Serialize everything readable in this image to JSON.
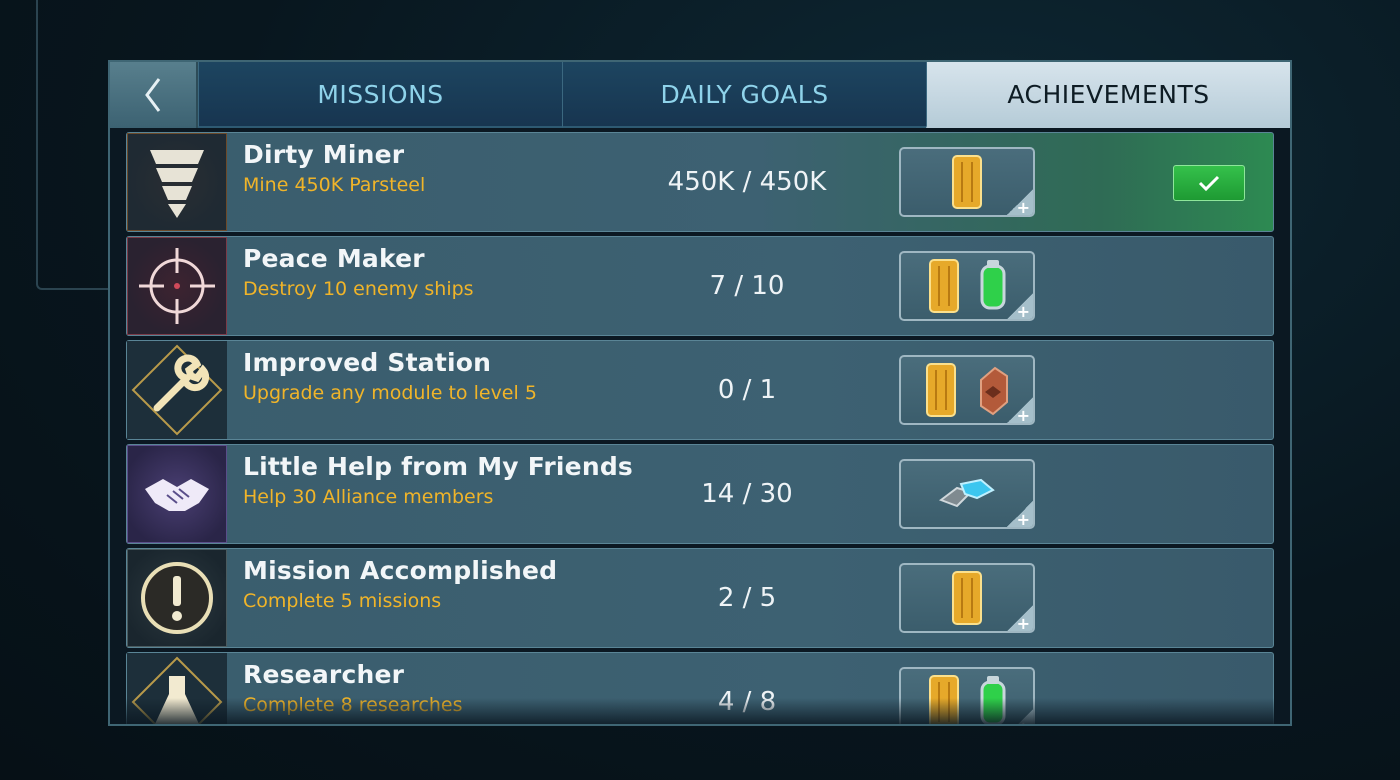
{
  "nav": {
    "back_icon": "chevron-left-icon",
    "tabs": [
      {
        "label": "MISSIONS",
        "active": false
      },
      {
        "label": "DAILY GOALS",
        "active": false
      },
      {
        "label": "ACHIEVEMENTS",
        "active": true
      }
    ]
  },
  "achievements": [
    {
      "title": "Dirty Miner",
      "description": "Mine 450K Parsteel",
      "progress": "450K / 450K",
      "badge_icon": "drill-icon",
      "rewards": [
        "gold-chip-icon"
      ],
      "completed": true
    },
    {
      "title": "Peace Maker",
      "description": "Destroy 10 enemy ships",
      "progress": "7 / 10",
      "badge_icon": "crosshair-icon",
      "rewards": [
        "gold-chip-icon",
        "green-canister-icon"
      ],
      "completed": false
    },
    {
      "title": "Improved Station",
      "description": "Upgrade any module to level 5",
      "progress": "0 / 1",
      "badge_icon": "wrench-icon",
      "rewards": [
        "gold-chip-icon",
        "copper-crate-icon"
      ],
      "completed": false
    },
    {
      "title": "Little Help from My Friends",
      "description": "Help 30 Alliance members",
      "progress": "14 / 30",
      "badge_icon": "handshake-icon",
      "rewards": [
        "blue-crystal-icon"
      ],
      "completed": false
    },
    {
      "title": "Mission Accomplished",
      "description": "Complete 5 missions",
      "progress": "2 / 5",
      "badge_icon": "exclamation-icon",
      "rewards": [
        "gold-chip-icon"
      ],
      "completed": false
    },
    {
      "title": "Researcher",
      "description": "Complete 8 researches",
      "progress": "4 / 8",
      "badge_icon": "flask-icon",
      "rewards": [
        "gold-chip-icon",
        "green-canister-icon"
      ],
      "completed": false
    }
  ],
  "colors": {
    "accent_tab_text": "#8fd3ea",
    "description_text": "#f0b429",
    "claim_green": "#2aae40"
  }
}
